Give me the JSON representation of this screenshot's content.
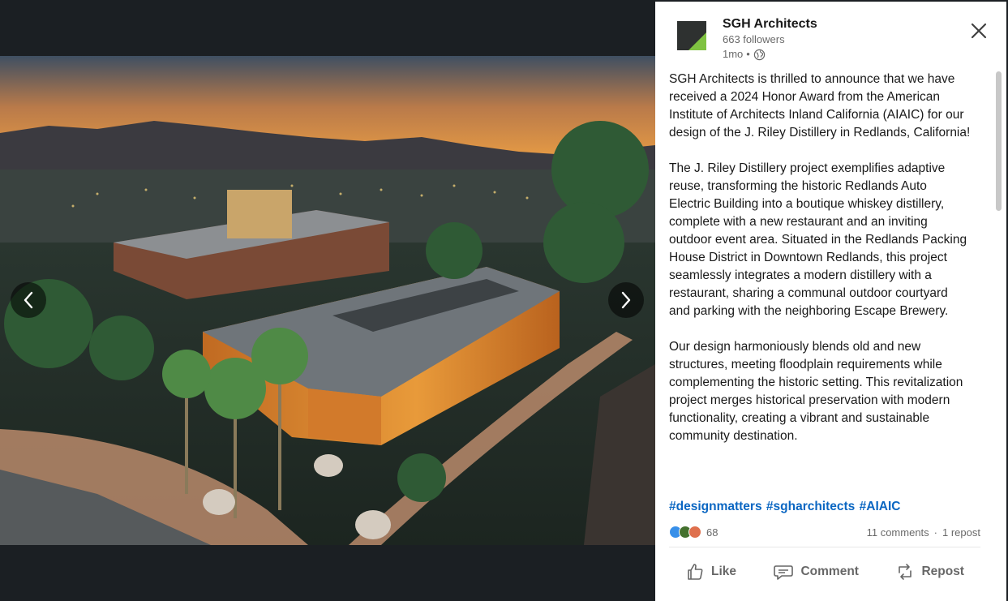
{
  "viewer": {
    "prev_icon": "chevron-left-icon",
    "next_icon": "chevron-right-icon"
  },
  "post": {
    "author": {
      "name": "SGH Architects",
      "followers": "663 followers",
      "time": "1mo",
      "separator": "•",
      "visibility_icon": "globe-icon"
    },
    "paragraphs": [
      "SGH Architects is thrilled to announce that we have received a 2024 Honor Award from the American Institute of Architects Inland California (AIAIC) for our design of the J. Riley Distillery in Redlands, California!",
      "The J. Riley Distillery project exemplifies adaptive reuse, transforming the historic Redlands Auto Electric Building into a boutique whiskey distillery, complete with a new restaurant and an inviting outdoor event area. Situated in the Redlands Packing House District in Downtown Redlands, this project seamlessly integrates a modern distillery with a restaurant, sharing a communal outdoor courtyard and parking with the neighboring Escape Brewery.",
      "Our design harmoniously blends old and new structures, meeting floodplain requirements while complementing the historic setting. This revitalization project merges historical preservation with modern functionality, creating a vibrant and sustainable community destination."
    ],
    "hashtags": [
      "#designmatters",
      "#sgharchitects",
      "#AIAIC"
    ],
    "reaction_count": "68",
    "comments": "11 comments",
    "dot": "·",
    "reposts": "1 repost",
    "actions": {
      "like": "Like",
      "comment": "Comment",
      "repost": "Repost"
    }
  },
  "colors": {
    "link": "#0a66c2",
    "like_blue": "#378fe9",
    "celebrate_green": "#44712e",
    "love_red": "#df704d"
  }
}
